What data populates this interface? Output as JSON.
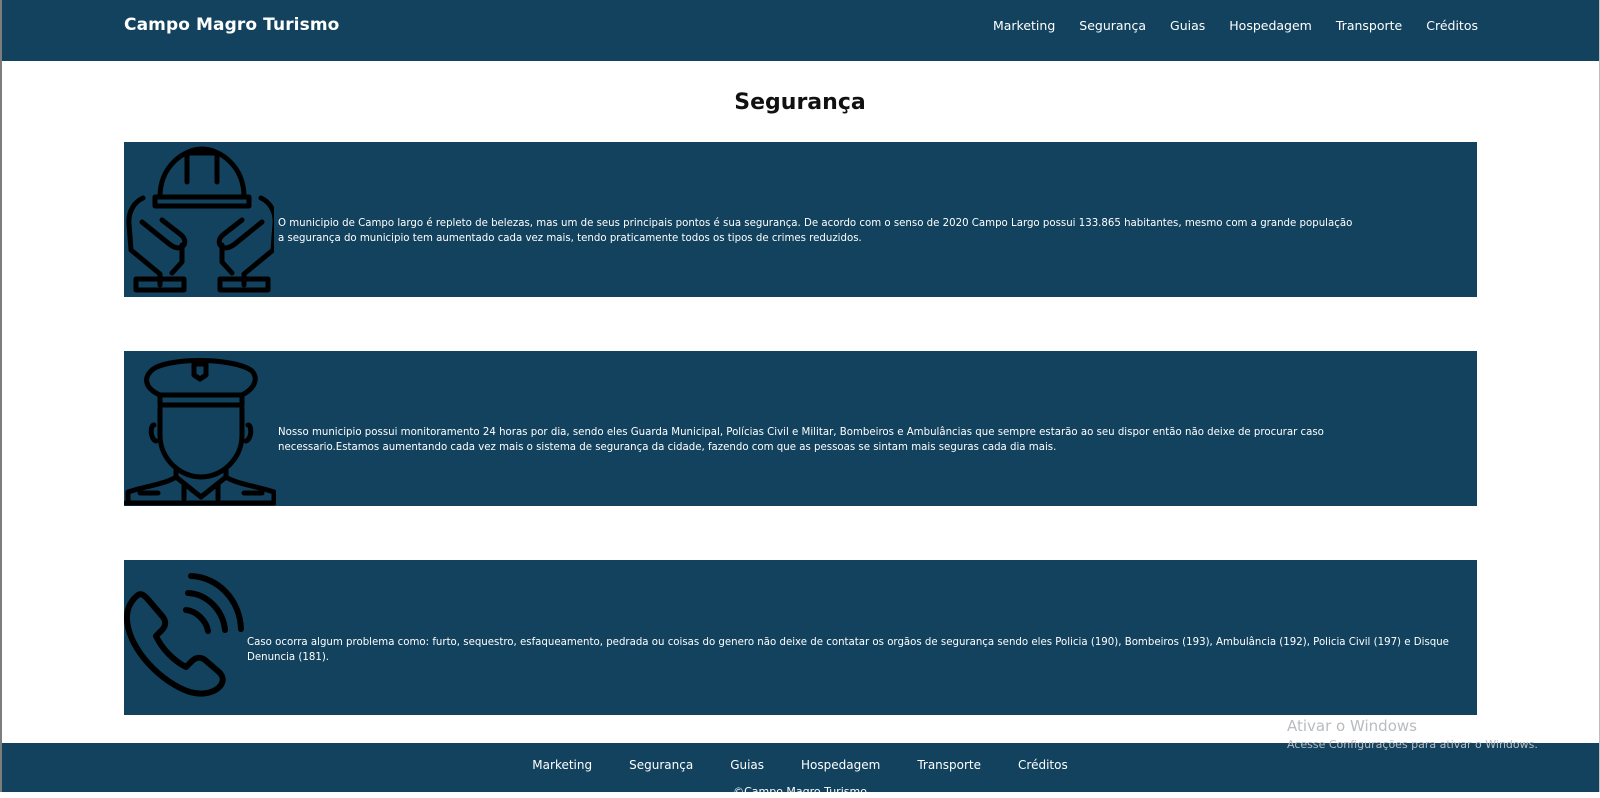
{
  "header": {
    "brand": "Campo Magro Turismo",
    "nav": [
      "Marketing",
      "Segurança",
      "Guias",
      "Hospedagem",
      "Transporte",
      "Créditos"
    ]
  },
  "main": {
    "title": "Segurança",
    "cards": [
      {
        "icon": "hands-helmet-icon",
        "text": "O municipio de Campo largo é repleto de belezas, mas um de seus principais pontos é sua segurança. De acordo com o senso de 2020 Campo Largo possui 133.865 habitantes, mesmo com a grande população a segurança do municipio tem aumentado cada vez mais, tendo praticamente todos os tipos de crimes reduzidos."
      },
      {
        "icon": "police-officer-icon",
        "text": "Nosso municipio possui monitoramento 24 horas por dia, sendo eles Guarda Municipal, Polícias Civil e Militar, Bombeiros e Ambulâncias que sempre estarão ao seu dispor então não deixe de procurar caso necessario.Estamos aumentando cada vez mais o sistema de segurança da cidade, fazendo com que as pessoas se sintam mais seguras cada dia mais."
      },
      {
        "icon": "phone-call-icon",
        "text": "Caso ocorra algum problema como: furto, sequestro, esfaqueamento, pedrada ou coisas do genero não deixe de contatar os orgãos de segurança sendo eles Policia (190), Bombeiros (193), Ambulância (192), Policia Civil (197) e Disque Denuncia (181)."
      }
    ]
  },
  "footer": {
    "nav": [
      "Marketing",
      "Segurança",
      "Guias",
      "Hospedagem",
      "Transporte",
      "Créditos"
    ],
    "copyright": "©Campo Magro Turismo"
  },
  "system_overlay": {
    "title": "Ativar o Windows",
    "subtitle": "Acesse Configurações para ativar o Windows."
  },
  "colors": {
    "primary": "#12425e",
    "background": "#ffffff",
    "text_on_primary": "#ffffff"
  }
}
